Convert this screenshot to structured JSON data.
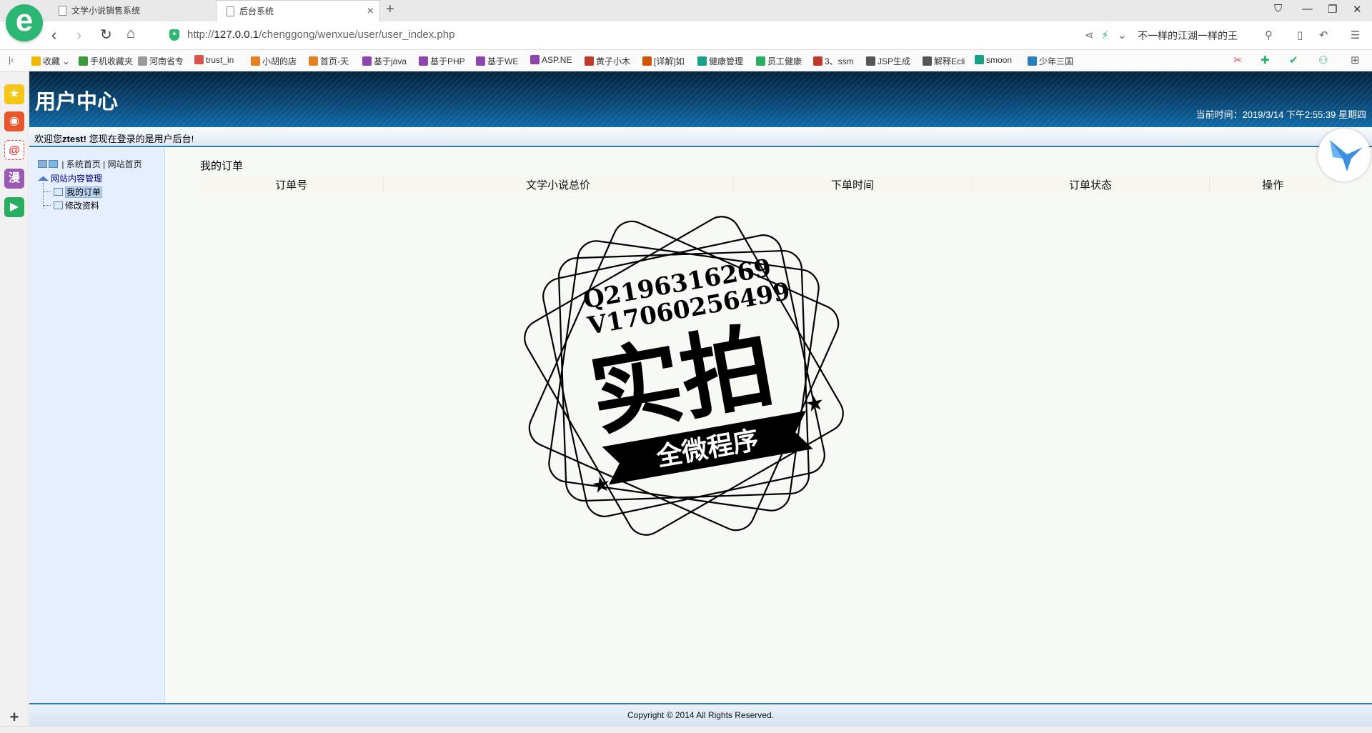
{
  "browser": {
    "tabs": [
      {
        "title": "文学小说销售系统"
      },
      {
        "title": "后台系统"
      }
    ],
    "url": {
      "scheme": "http://",
      "host": "127.0.0.1",
      "path": "/chenggong/wenxue/user/user_index.php"
    },
    "search_text": "不一样的江湖一样的王",
    "bookmarks": [
      {
        "label": "收藏",
        "color": "#f2b705"
      },
      {
        "label": "手机收藏夹",
        "color": "#3a9a3a"
      },
      {
        "label": "河南省专",
        "color": "#999999"
      },
      {
        "label": "trust_in",
        "color": "#d9534f"
      },
      {
        "label": "小胡的店",
        "color": "#e67e22"
      },
      {
        "label": "首页-天",
        "color": "#e67e22"
      },
      {
        "label": "基于java",
        "color": "#8e44ad"
      },
      {
        "label": "基于PHP",
        "color": "#8e44ad"
      },
      {
        "label": "基于WE",
        "color": "#8e44ad"
      },
      {
        "label": "ASP.NE",
        "color": "#8e44ad"
      },
      {
        "label": "黄子小木",
        "color": "#c0392b"
      },
      {
        "label": "[详解]如",
        "color": "#d35400"
      },
      {
        "label": "健康管理",
        "color": "#16a085"
      },
      {
        "label": "员工健康",
        "color": "#27ae60"
      },
      {
        "label": "3、ssm",
        "color": "#c0392b"
      },
      {
        "label": "JSP生成",
        "color": "#555555"
      },
      {
        "label": "解释Ecli",
        "color": "#555555"
      },
      {
        "label": "smoon",
        "color": "#16a085"
      },
      {
        "label": "少年三国",
        "color": "#2980b9"
      }
    ]
  },
  "header": {
    "title": "用户中心",
    "clock": "当前时间：2019/3/14 下午2:55:39 星期四"
  },
  "welcome": {
    "prefix": "欢迎您",
    "user": "ztest!",
    "suffix": " 您现在登录的是用户后台!"
  },
  "sidebar": {
    "top_links": [
      "系统首页",
      "网站首页"
    ],
    "sep": "|",
    "root": "网站内容管理",
    "items": [
      {
        "label": "我的订单",
        "selected": true
      },
      {
        "label": "修改资料",
        "selected": false
      }
    ]
  },
  "orders": {
    "title": "我的订单",
    "columns": [
      "订单号",
      "文学小说总价",
      "下单时间",
      "订单状态",
      "操作"
    ],
    "rows": []
  },
  "watermark": {
    "line1": "Q2196316269",
    "line2": "V17060256499",
    "big": "实拍",
    "ribbon": "全微程序"
  },
  "footer": {
    "copyright": "Copyright © 2014 All Rights Reserved."
  }
}
